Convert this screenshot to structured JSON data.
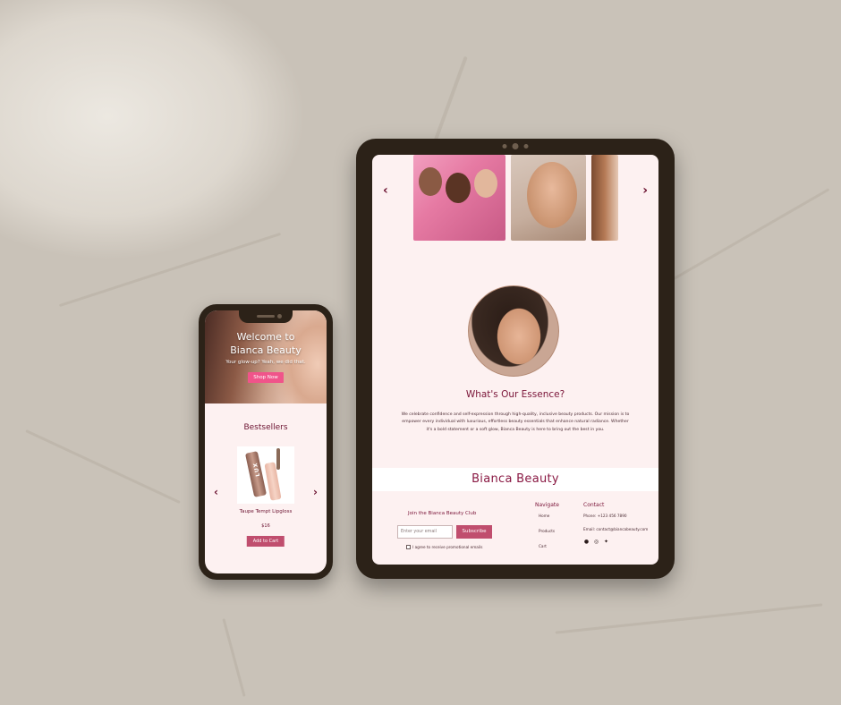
{
  "phone": {
    "hero": {
      "title_line1": "Welcome to",
      "title_line2": "Bianca Beauty",
      "subtitle": "Your glow-up? Yeah, we did that.",
      "button": "Shop Now"
    },
    "bestsellers_title": "Bestsellers",
    "arrow_left": "‹",
    "arrow_right": "›",
    "product": {
      "brand_text": "LUX",
      "name": "Taupe Tempt Lipgloss",
      "price": "$16",
      "button": "Add to Cart"
    }
  },
  "tablet": {
    "arrow_left": "‹",
    "arrow_right": "›",
    "heading": "What's Our Essence?",
    "body": "We celebrate confidence and self-expression through high-quality, inclusive beauty products. Our mission is to empower every individual with luxurious, effortless beauty essentials that enhance natural radiance. Whether it's a bold statement or a soft glow, Bianca Beauty is here to bring out the best in you.",
    "brand": "Bianca Beauty",
    "footer": {
      "join_title": "Join the Bianca Beauty Club",
      "email_placeholder": "Enter your email",
      "subscribe": "Subscribe",
      "agree": "I agree to receive promotional emails",
      "navigate_title": "Navigate",
      "nav_items": [
        "Home",
        "Products",
        "Cart"
      ],
      "contact_title": "Contact",
      "phone": "Phone: +123 456 7890",
      "email": "Email: contact@biancabeauty.com",
      "social_icons": [
        "facebook-icon",
        "instagram-icon",
        "twitter-icon"
      ]
    }
  }
}
